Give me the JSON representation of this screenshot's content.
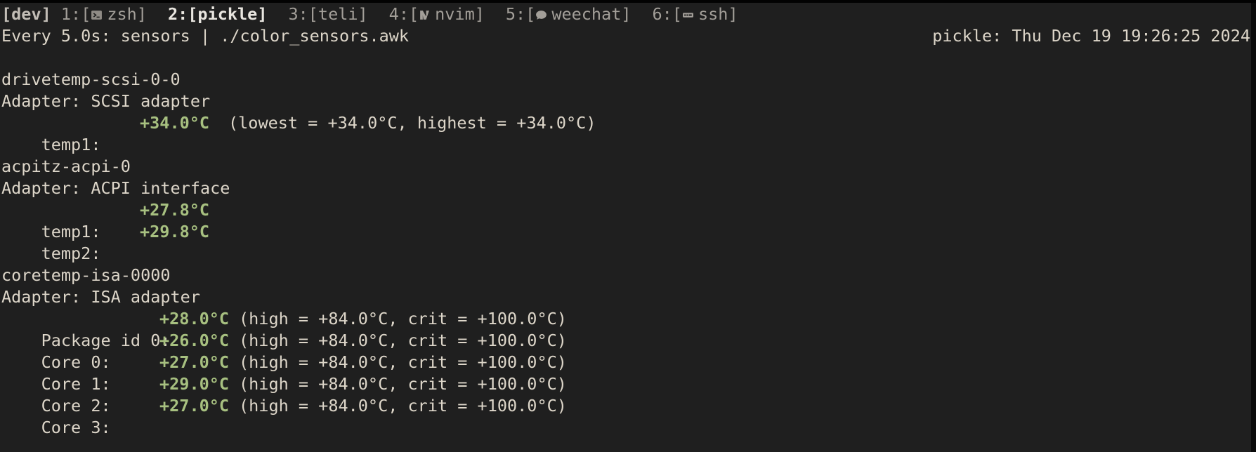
{
  "statusbar": {
    "session": "[dev]",
    "windows": [
      {
        "index": "1:",
        "open": "[",
        "icon": "terminal-icon",
        "name": "zsh",
        "close": "]",
        "active": false
      },
      {
        "index": "2:",
        "open": "[",
        "icon": "",
        "name": "pickle",
        "close": "]",
        "active": true
      },
      {
        "index": "3:",
        "open": "[",
        "icon": "",
        "name": "teli",
        "close": "]",
        "active": false
      },
      {
        "index": "4:",
        "open": "[",
        "icon": "neovim-icon",
        "name": "nvim",
        "close": "]",
        "active": false
      },
      {
        "index": "5:",
        "open": "[",
        "icon": "chat-bubble-icon",
        "name": "weechat",
        "close": "]",
        "active": false
      },
      {
        "index": "6:",
        "open": "[",
        "icon": "ssh-icon",
        "name": "ssh",
        "close": "]",
        "active": false
      }
    ]
  },
  "watch": {
    "command": "Every 5.0s: sensors | ./color_sensors.awk",
    "host_time": "pickle: Thu Dec 19 19:26:25 2024"
  },
  "sensors": {
    "drivetemp": {
      "name": "drivetemp-scsi-0-0",
      "adapter": "Adapter: SCSI adapter",
      "temp1": {
        "label": "temp1:",
        "value": "+34.0°C",
        "extra": "(lowest = +34.0°C, highest = +34.0°C)"
      }
    },
    "acpitz": {
      "name": "acpitz-acpi-0",
      "adapter": "Adapter: ACPI interface",
      "temps": [
        {
          "label": "temp1:",
          "value": "+27.8°C"
        },
        {
          "label": "temp2:",
          "value": "+29.8°C"
        }
      ]
    },
    "coretemp": {
      "name": "coretemp-isa-0000",
      "adapter": "Adapter: ISA adapter",
      "rows": [
        {
          "label": "Package id 0:",
          "value": "+28.0°C",
          "extra": "(high = +84.0°C, crit = +100.0°C)"
        },
        {
          "label": "Core 0:",
          "value": "+26.0°C",
          "extra": "(high = +84.0°C, crit = +100.0°C)"
        },
        {
          "label": "Core 1:",
          "value": "+27.0°C",
          "extra": "(high = +84.0°C, crit = +100.0°C)"
        },
        {
          "label": "Core 2:",
          "value": "+29.0°C",
          "extra": "(high = +84.0°C, crit = +100.0°C)"
        },
        {
          "label": "Core 3:",
          "value": "+27.0°C",
          "extra": "(high = +84.0°C, crit = +100.0°C)"
        }
      ]
    }
  },
  "colors": {
    "background": "#1f1f1f",
    "foreground": "#ddd6c9",
    "temperature_value": "#a7c080",
    "statusbar_inactive": "#a39f99"
  }
}
